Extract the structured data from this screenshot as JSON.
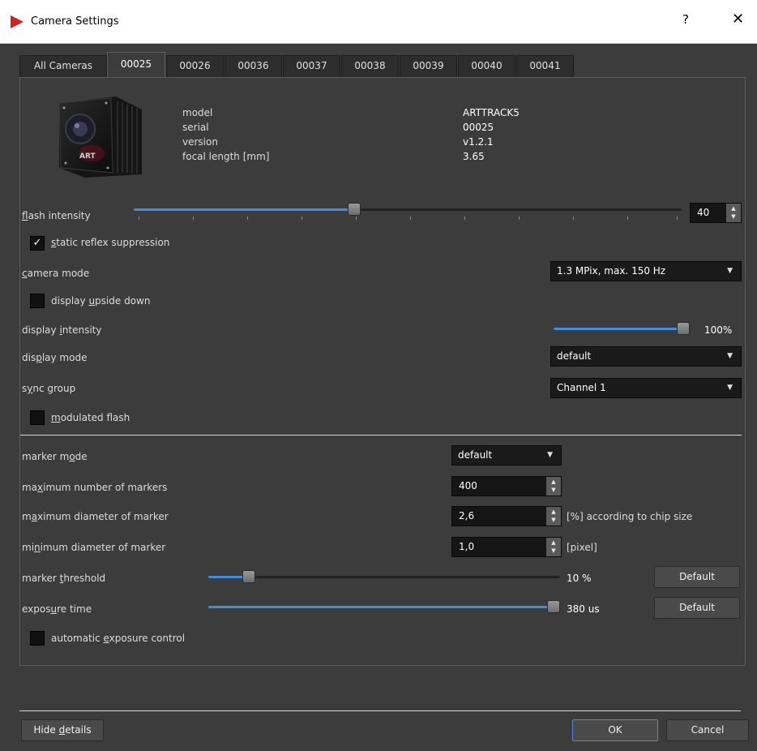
{
  "window": {
    "title": "Camera Settings",
    "help_label": "?",
    "close_label": "✕"
  },
  "tabs": [
    "All Cameras",
    "00025",
    "00026",
    "00036",
    "00037",
    "00038",
    "00039",
    "00040",
    "00041"
  ],
  "active_tab": "00025",
  "camera_info": {
    "image_brand": "ART",
    "model_label": "model",
    "model_value": "ARTTRACK5",
    "serial_label": "serial",
    "serial_value": "00025",
    "version_label": "version",
    "version_value": "v1.2.1",
    "focal_label": "focal length [mm]",
    "focal_value": "3.65"
  },
  "flash_intensity": {
    "label_mnemonic": "f",
    "label_rest": "lash intensity",
    "value": "40",
    "fraction": 0.4
  },
  "static_reflex": {
    "checked": true,
    "check_glyph": "✓",
    "label_mnemonic": "s",
    "label_rest": "tatic reflex suppression"
  },
  "camera_mode": {
    "label_mnemonic": "c",
    "label_rest": "amera mode",
    "value": "1.3 MPix, max. 150 Hz"
  },
  "display_upside_down": {
    "checked": false,
    "label_pre": "display ",
    "label_mnemonic": "u",
    "label_rest": "pside down"
  },
  "display_intensity": {
    "label_pre": "display ",
    "label_mnemonic": "i",
    "label_rest": "ntensity",
    "value": "100%",
    "fraction": 1.0
  },
  "display_mode": {
    "label_pre": "dis",
    "label_mnemonic": "p",
    "label_rest": "lay mode",
    "value": "default"
  },
  "sync_group": {
    "label_pre": "s",
    "label_mnemonic": "y",
    "label_rest": "nc group",
    "value": "Channel 1"
  },
  "modulated_flash": {
    "checked": false,
    "label_mnemonic": "m",
    "label_rest": "odulated flash"
  },
  "marker_mode": {
    "label_pre": "marker m",
    "label_mnemonic": "o",
    "label_rest": "de",
    "value": "default"
  },
  "max_markers": {
    "label_pre": "ma",
    "label_mnemonic": "x",
    "label_rest": "imum number of markers",
    "value": "400"
  },
  "max_diameter": {
    "label_pre": "m",
    "label_mnemonic": "a",
    "label_rest": "ximum diameter of marker",
    "value": "2,6",
    "unit": "[%] according to chip size"
  },
  "min_diameter": {
    "label_pre": "mi",
    "label_mnemonic": "n",
    "label_rest": "imum diameter of marker",
    "value": "1,0",
    "unit": "[pixel]"
  },
  "marker_threshold": {
    "label_pre": "marker ",
    "label_mnemonic": "t",
    "label_rest": "hreshold",
    "value": "10 %",
    "fraction": 0.1,
    "default_button": "Default"
  },
  "exposure_time": {
    "label_pre": "expos",
    "label_mnemonic": "u",
    "label_rest": "re time",
    "value": "380 us",
    "fraction": 1.0,
    "default_button": "Default"
  },
  "auto_exposure": {
    "checked": false,
    "label_pre": "automatic ",
    "label_mnemonic": "e",
    "label_rest": "xposure control"
  },
  "footer": {
    "hide_pre": "Hide ",
    "hide_mnemonic": "d",
    "hide_rest": "etails",
    "ok_label": "OK",
    "cancel_label": "Cancel"
  }
}
